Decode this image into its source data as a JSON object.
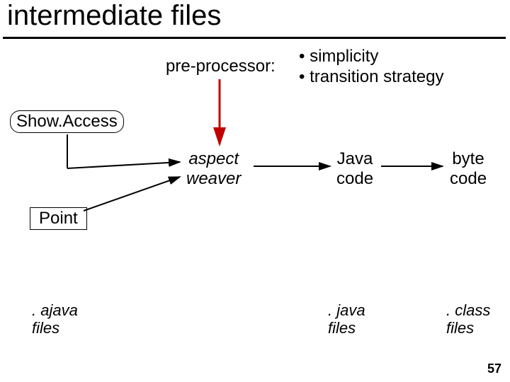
{
  "title": "intermediate files",
  "preprocessor_label": "pre-processor:",
  "bullets": {
    "b1": "• simplicity",
    "b2": "• transition strategy"
  },
  "boxes": {
    "show_access": "Show.Access",
    "point": "Point"
  },
  "stages": {
    "aspect_weaver_l1": "aspect",
    "aspect_weaver_l2": "weaver",
    "java_l1": "Java",
    "java_l2": "code",
    "byte_l1": "byte",
    "byte_l2": "code"
  },
  "captions": {
    "ajava_l1": ". ajava",
    "ajava_l2": "files",
    "java_l1": ". java",
    "java_l2": "files",
    "class_l1": ". class",
    "class_l2": "files"
  },
  "slide_number": "57",
  "colors": {
    "red": "#c00000",
    "black": "#000000"
  }
}
